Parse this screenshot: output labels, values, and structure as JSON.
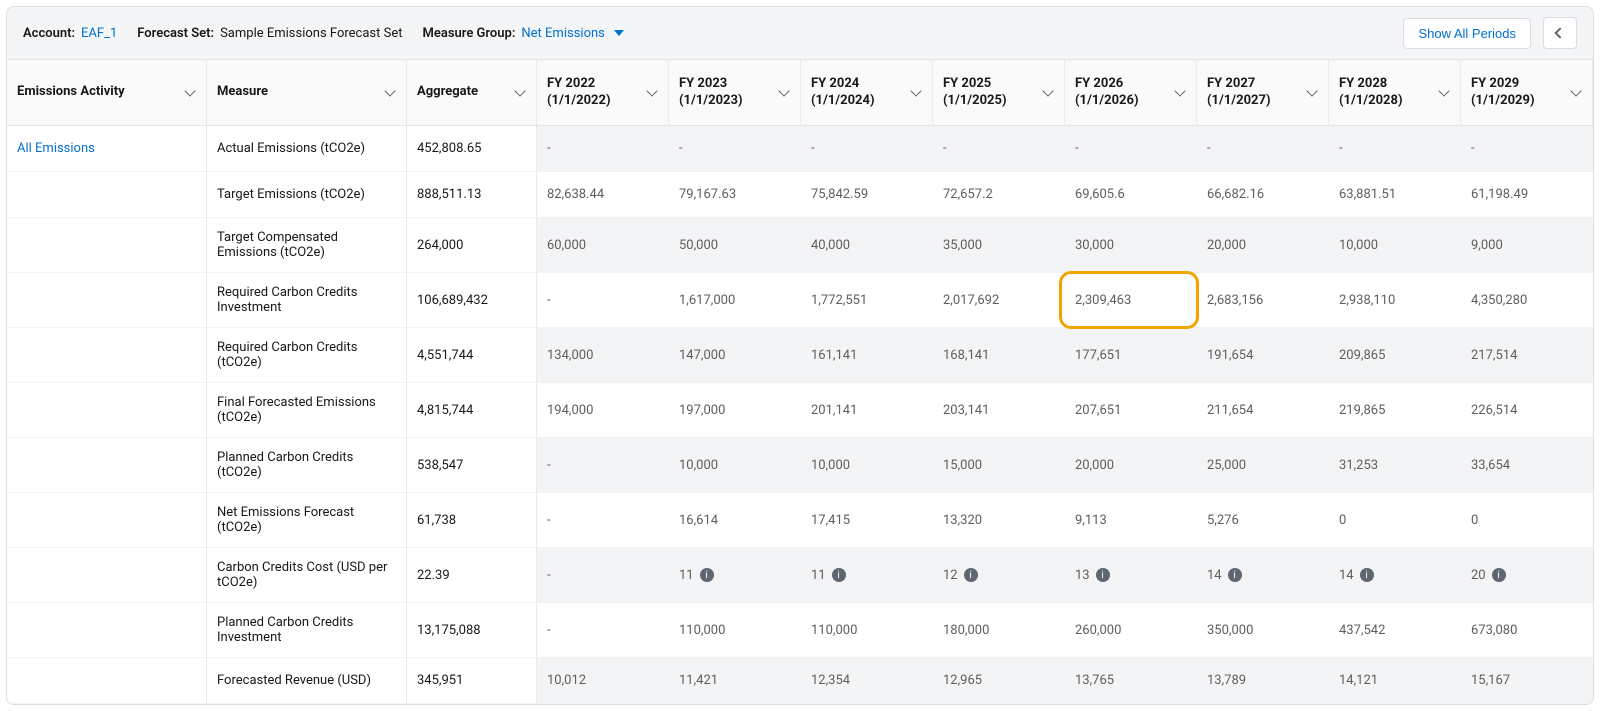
{
  "toolbar": {
    "accountLabel": "Account:",
    "accountValue": "EAF_1",
    "forecastSetLabel": "Forecast Set:",
    "forecastSetValue": "Sample Emissions Forecast Set",
    "measureGroupLabel": "Measure Group:",
    "measureGroupValue": "Net Emissions",
    "showAll": "Show All Periods"
  },
  "headers": {
    "activity": "Emissions Activity",
    "measure": "Measure",
    "aggregate": "Aggregate",
    "periods": [
      "FY 2022 (1/1/2022)",
      "FY 2023 (1/1/2023)",
      "FY 2024 (1/1/2024)",
      "FY 2025 (1/1/2025)",
      "FY 2026 (1/1/2026)",
      "FY 2027 (1/1/2027)",
      "FY 2028 (1/1/2028)",
      "FY 2029 (1/1/2029)"
    ]
  },
  "groupLabel": "All Emissions",
  "rows": [
    {
      "measure": "Actual Emissions (tCO2e)",
      "agg": "452,808.65",
      "alt": true,
      "vals": [
        "-",
        "-",
        "-",
        "-",
        "-",
        "-",
        "-",
        "-"
      ]
    },
    {
      "measure": "Target Emissions (tCO2e)",
      "agg": "888,511.13",
      "alt": false,
      "vals": [
        "82,638.44",
        "79,167.63",
        "75,842.59",
        "72,657.2",
        "69,605.6",
        "66,682.16",
        "63,881.51",
        "61,198.49"
      ]
    },
    {
      "measure": "Target Compensated Emissions (tCO2e)",
      "agg": "264,000",
      "alt": true,
      "vals": [
        "60,000",
        "50,000",
        "40,000",
        "35,000",
        "30,000",
        "20,000",
        "10,000",
        "9,000"
      ]
    },
    {
      "measure": "Required Carbon Credits Investment",
      "agg": "106,689,432",
      "alt": false,
      "highlightCol": 4,
      "vals": [
        "-",
        "1,617,000",
        "1,772,551",
        "2,017,692",
        "2,309,463",
        "2,683,156",
        "2,938,110",
        "4,350,280"
      ]
    },
    {
      "measure": "Required Carbon Credits (tCO2e)",
      "agg": "4,551,744",
      "alt": true,
      "vals": [
        "134,000",
        "147,000",
        "161,141",
        "168,141",
        "177,651",
        "191,654",
        "209,865",
        "217,514"
      ]
    },
    {
      "measure": "Final Forecasted Emissions (tCO2e)",
      "agg": "4,815,744",
      "alt": false,
      "vals": [
        "194,000",
        "197,000",
        "201,141",
        "203,141",
        "207,651",
        "211,654",
        "219,865",
        "226,514"
      ]
    },
    {
      "measure": "Planned Carbon Credits (tCO2e)",
      "agg": "538,547",
      "alt": true,
      "vals": [
        "-",
        "10,000",
        "10,000",
        "15,000",
        "20,000",
        "25,000",
        "31,253",
        "33,654"
      ]
    },
    {
      "measure": "Net Emissions Forecast (tCO2e)",
      "agg": "61,738",
      "alt": false,
      "vals": [
        "-",
        "16,614",
        "17,415",
        "13,320",
        "9,113",
        "5,276",
        "0",
        "0"
      ]
    },
    {
      "measure": "Carbon Credits Cost (USD per tCO2e)",
      "agg": "22.39",
      "alt": true,
      "info": true,
      "vals": [
        "-",
        "11",
        "11",
        "12",
        "13",
        "14",
        "14",
        "20"
      ]
    },
    {
      "measure": "Planned Carbon Credits Investment",
      "agg": "13,175,088",
      "alt": false,
      "vals": [
        "-",
        "110,000",
        "110,000",
        "180,000",
        "260,000",
        "350,000",
        "437,542",
        "673,080"
      ]
    },
    {
      "measure": "Forecasted Revenue (USD)",
      "agg": "345,951",
      "alt": true,
      "vals": [
        "10,012",
        "11,421",
        "12,354",
        "12,965",
        "13,765",
        "13,789",
        "14,121",
        "15,167"
      ]
    }
  ]
}
